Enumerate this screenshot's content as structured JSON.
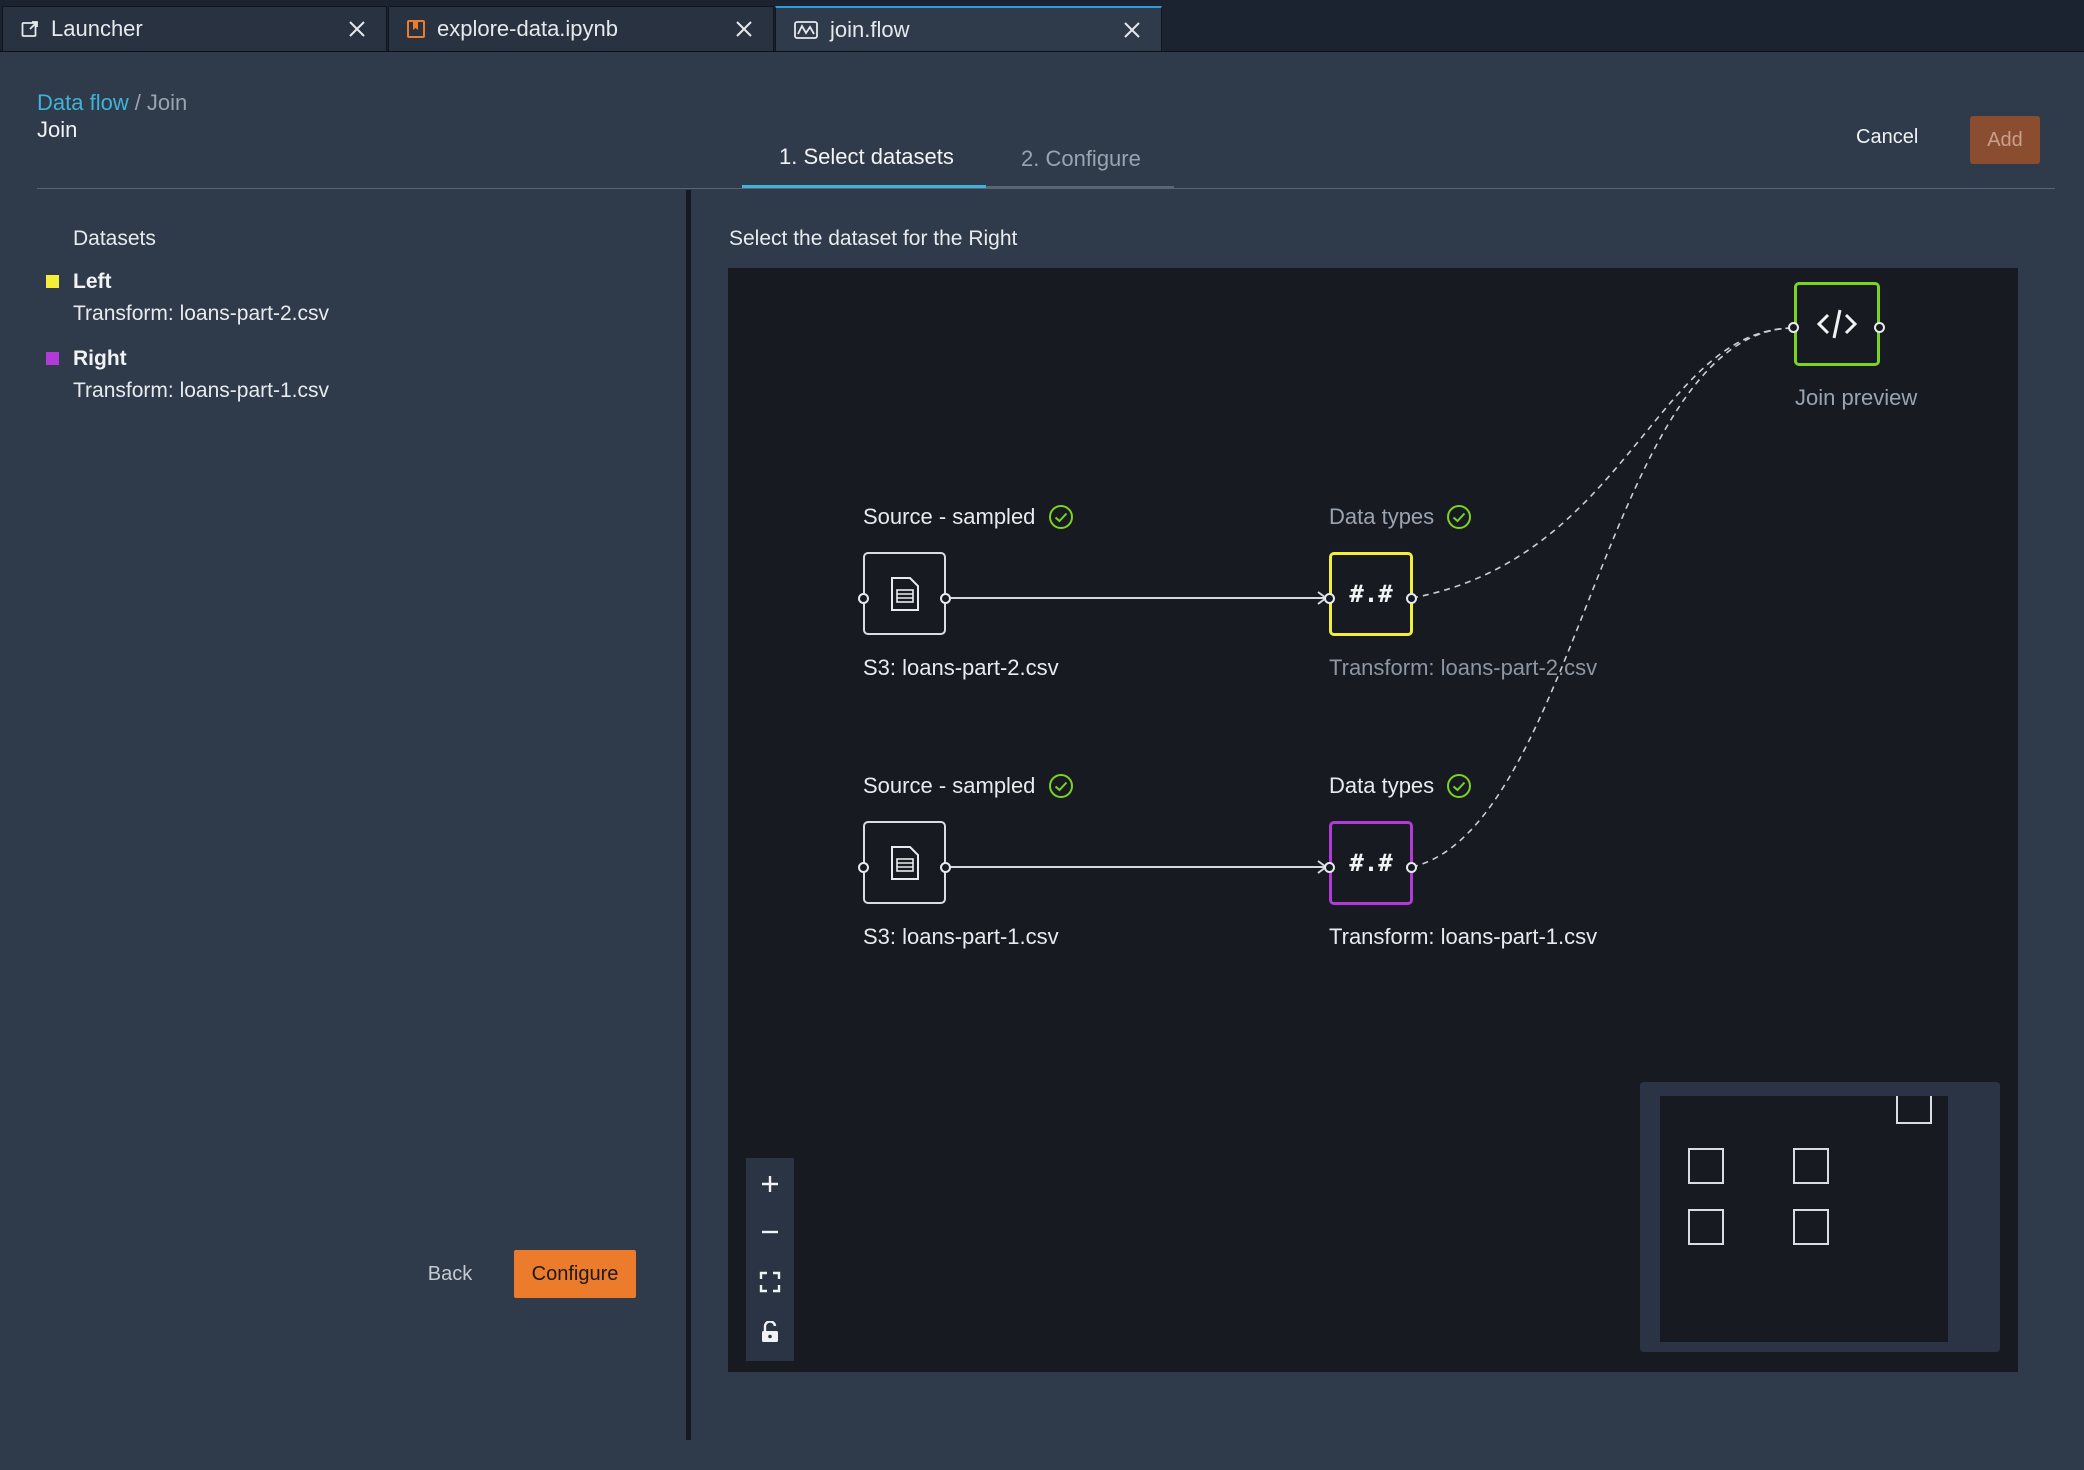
{
  "tabs": [
    {
      "label": "Launcher",
      "icon": "external-link-icon"
    },
    {
      "label": "explore-data.ipynb",
      "icon": "notebook-icon"
    },
    {
      "label": "join.flow",
      "icon": "flow-icon"
    }
  ],
  "breadcrumb": {
    "root": "Data flow",
    "separator": "/",
    "current": "Join"
  },
  "page_title": "Join",
  "steps": [
    "1. Select datasets",
    "2. Configure"
  ],
  "actions": {
    "cancel": "Cancel",
    "add": "Add"
  },
  "datasets": {
    "title": "Datasets",
    "left": {
      "name": "Left",
      "value": "Transform: loans-part-2.csv",
      "color": "#f3ee3a"
    },
    "right": {
      "name": "Right",
      "value": "Transform: loans-part-1.csv",
      "color": "#b23bd8"
    }
  },
  "left_actions": {
    "back": "Back",
    "configure": "Configure"
  },
  "canvas": {
    "heading": "Select the dataset for the Right",
    "nodes": {
      "source1": {
        "title": "Source - sampled",
        "label": "S3: loans-part-2.csv"
      },
      "types1": {
        "title": "Data types",
        "label": "Transform: loans-part-2.csv",
        "symbol": "#.#"
      },
      "source2": {
        "title": "Source - sampled",
        "label": "S3: loans-part-1.csv"
      },
      "types2": {
        "title": "Data types",
        "label": "Transform: loans-part-1.csv",
        "symbol": "#.#"
      },
      "join": {
        "label": "Join preview",
        "symbol": "</>"
      }
    }
  },
  "colors": {
    "accent": "#3fb3d8",
    "primary_button": "#ec7b2c",
    "left_node": "#f3ee3a",
    "right_node": "#b23bd8",
    "join_node": "#7ed321",
    "success": "#7ed321"
  }
}
